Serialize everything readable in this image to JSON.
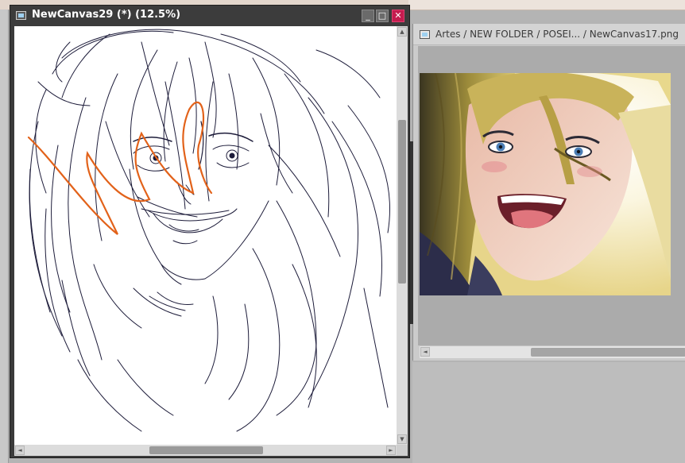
{
  "main_window": {
    "title": "NewCanvas29 (*) (12.5%)",
    "buttons": {
      "minimize": "_",
      "maximize": "□",
      "close": "✕"
    }
  },
  "second_window": {
    "title": "Artes / NEW FOLDER / POSEI...  / NewCanvas17.png"
  },
  "scroll_arrows": {
    "up": "▲",
    "down": "▼",
    "left": "◄",
    "right": "►"
  },
  "colors": {
    "titlebar_dark": "#3c3c3c",
    "close_button": "#c41c4f",
    "sketch_line": "#1d1c3a",
    "scribble": "#e2621a",
    "hair_blonde": "#d8c36a"
  },
  "icons": [
    "window-icon",
    "minimize-icon",
    "maximize-icon",
    "close-icon",
    "scroll-arrow-icon",
    "resize-grip-icon"
  ]
}
